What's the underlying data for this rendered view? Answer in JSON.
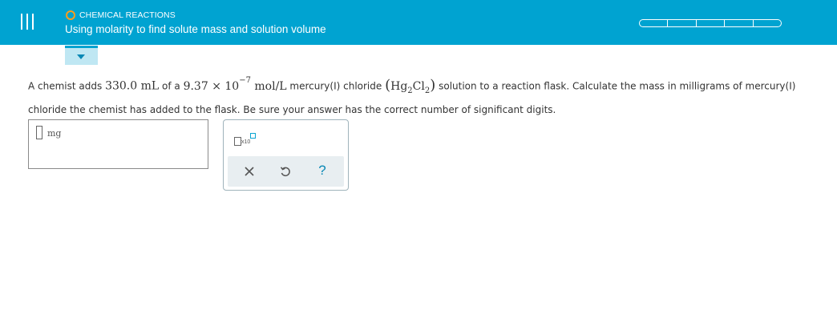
{
  "header": {
    "topic": "CHEMICAL REACTIONS",
    "title": "Using molarity to find solute mass and solution volume",
    "progress_segments": 5,
    "progress_filled": 0,
    "colors": {
      "bar": "#00a3d1",
      "topic_dot": "#ff9d1a",
      "text": "#ffffff"
    }
  },
  "question": {
    "t1": "A chemist adds ",
    "volume_value": "330.0",
    "volume_unit": "mL",
    "t2": " of a ",
    "conc_mantissa": "9.37",
    "times": "×",
    "conc_base": "10",
    "conc_exponent": "−7",
    "conc_unit": "mol/L",
    "t3": " mercury(I) chloride ",
    "formula_hg": "Hg",
    "formula_hg_sub": "2",
    "formula_cl": "Cl",
    "formula_cl_sub": "2",
    "t4": " solution to a reaction flask. Calculate the mass in milligrams of mercury(I) chloride the chemist has added to the flask. Be sure your answer has the correct number of significant digits."
  },
  "answer": {
    "value": "",
    "unit": "mg"
  },
  "tools": {
    "sci_notation_label": "x10",
    "clear_icon": "close-icon",
    "undo_icon": "undo-icon",
    "help_label": "?"
  }
}
